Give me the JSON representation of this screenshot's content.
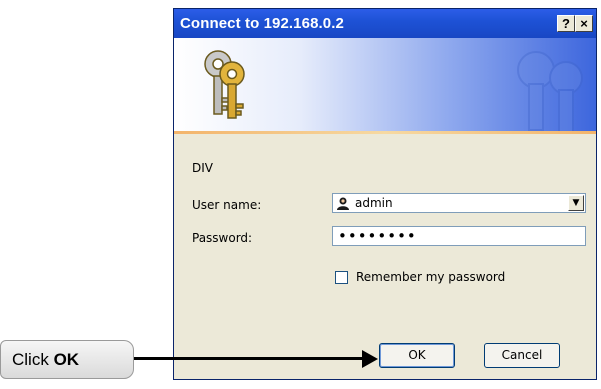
{
  "dialog": {
    "title": "Connect to 192.168.0.2",
    "help_button": "?",
    "close_button": "×",
    "realm": "DIV",
    "username_label": "User name:",
    "username_value": "admin",
    "password_label": "Password:",
    "password_value": "••••••••",
    "remember_label": "Remember my password",
    "remember_checked": false,
    "ok_label": "OK",
    "cancel_label": "Cancel"
  },
  "annotation": {
    "prefix": "Click ",
    "emphasis": "OK"
  },
  "colors": {
    "titlebar": "#1e52d6",
    "dialog_bg": "#ece9d8",
    "banner_stripe": "#f3b46b"
  },
  "icons": {
    "banner": "keys-icon",
    "username": "user-icon",
    "dropdown": "chevron-down-icon"
  }
}
